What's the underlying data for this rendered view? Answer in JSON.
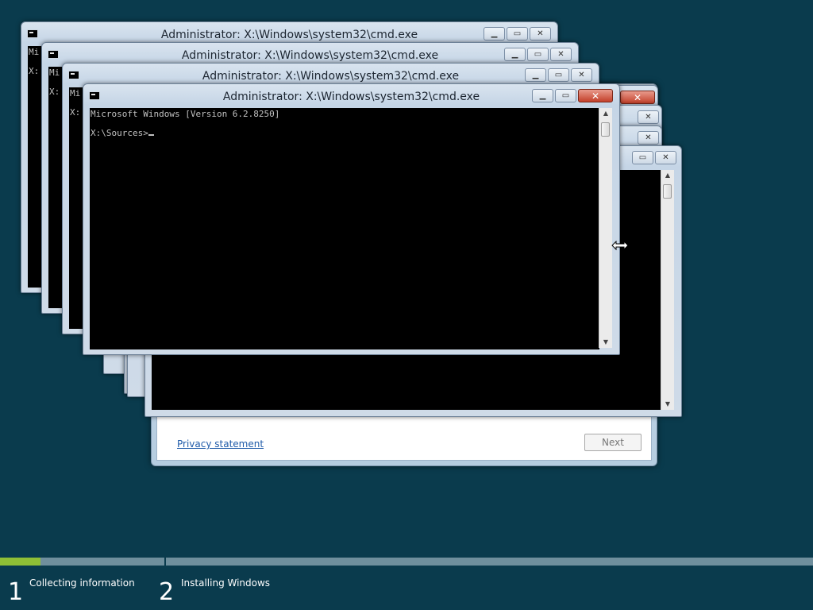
{
  "cmd_title": "Administrator: X:\\Windows\\system32\\cmd.exe",
  "console_peek_line1": "Mi",
  "console_peek_line2": "X:",
  "console_line1": "Microsoft Windows [Version 6.2.8250]",
  "console_line2": "X:\\Sources>",
  "setup": {
    "privacy_link": "Privacy statement",
    "next_button": "Next"
  },
  "progress": {
    "fraction_complete": 0.05,
    "steps": [
      {
        "number": "1",
        "label": "Collecting information"
      },
      {
        "number": "2",
        "label": "Installing Windows"
      }
    ],
    "accent": "#8fbf36"
  },
  "icons": {
    "close": "close-icon",
    "minimize": "minimize-icon",
    "maximize": "maximize-icon",
    "resize": "horizontal-resize-cursor"
  }
}
